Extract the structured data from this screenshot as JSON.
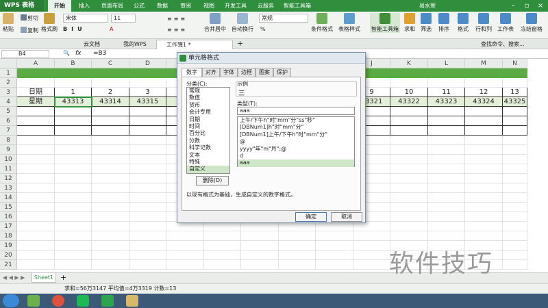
{
  "app": {
    "logo": "WPS 表格",
    "user": "易水寒"
  },
  "menu": [
    "开始",
    "插入",
    "页面布局",
    "公式",
    "数据",
    "审阅",
    "视图",
    "开发工具",
    "云服务",
    "智能工具箱"
  ],
  "ribbon": {
    "cut": "剪切",
    "copy": "复制",
    "paste": "粘贴",
    "format_painter": "格式刷",
    "font": "宋体",
    "size": "11",
    "merge": "合并居中",
    "wrap": "自动换行",
    "number_format": "常规",
    "percent": "%",
    "cond_format": "条件格式",
    "table_style": "表格样式",
    "smart_toolbox": "智能工具箱",
    "sum": "求和",
    "filter": "筛选",
    "sort": "排序",
    "format": "格式",
    "rowcol": "行和列",
    "worksheet": "工作表",
    "freeze": "冻结窗格",
    "search": "查找命令、搜索..."
  },
  "doc_tabs": [
    "云文档",
    "我的WPS",
    "工作簿1 *"
  ],
  "formula_bar": {
    "cell_ref": "B4",
    "fx": "fx",
    "formula": "=B3"
  },
  "columns": [
    "A",
    "B",
    "C",
    "D",
    "E",
    "F",
    "G",
    "H",
    "I",
    "J",
    "K",
    "L",
    "M",
    "N"
  ],
  "rows": [
    "1",
    "2",
    "3",
    "4",
    "5",
    "6",
    "7",
    "8",
    "9",
    "10",
    "11",
    "12",
    "13",
    "14",
    "15",
    "16",
    "17",
    "18",
    "19",
    "20",
    "21"
  ],
  "row3": {
    "label": "日期",
    "values": [
      "1",
      "2",
      "3",
      "",
      "",
      "",
      "",
      "",
      "9",
      "10",
      "11",
      "12",
      "13"
    ]
  },
  "row4": {
    "label": "星期",
    "values": [
      "43313",
      "43314",
      "43315",
      "",
      "",
      "",
      "",
      "",
      "43321",
      "43322",
      "43323",
      "43324",
      "43325"
    ]
  },
  "sheet_tab": "Sheet1",
  "status": "求和=56万3147   平均值=4万3319   计数=13",
  "watermark": "软件技巧",
  "dialog": {
    "title": "单元格格式",
    "tabs": [
      "数字",
      "对齐",
      "字体",
      "边框",
      "图案",
      "保护"
    ],
    "category_label": "分类(C):",
    "categories": [
      "常规",
      "数值",
      "货币",
      "会计专用",
      "日期",
      "时间",
      "百分比",
      "分数",
      "科学记数",
      "文本",
      "特殊",
      "自定义"
    ],
    "selected_category": "自定义",
    "sample_label": "示例",
    "sample_value": "三",
    "type_label": "类型(T):",
    "type_value": "aaa",
    "type_list": [
      "上午/下午h\"时\"mm\"分\"ss\"秒\"",
      "[DBNum1]h\"时\"mm\"分\"",
      "[DBNum1]上午/下午h\"时\"mm\"分\"",
      "@",
      "yyyy\"年\"m\"月\";@",
      "d",
      "aaa"
    ],
    "selected_type": "aaa",
    "delete_button": "删除(D)",
    "description": "以现有格式为基础，生成自定义的数字格式。",
    "ok": "确定",
    "cancel": "取消"
  },
  "colors": {
    "accent": "#2f8f3d",
    "header_band": "#5aab43",
    "selected_list": "#cfe6c8"
  }
}
